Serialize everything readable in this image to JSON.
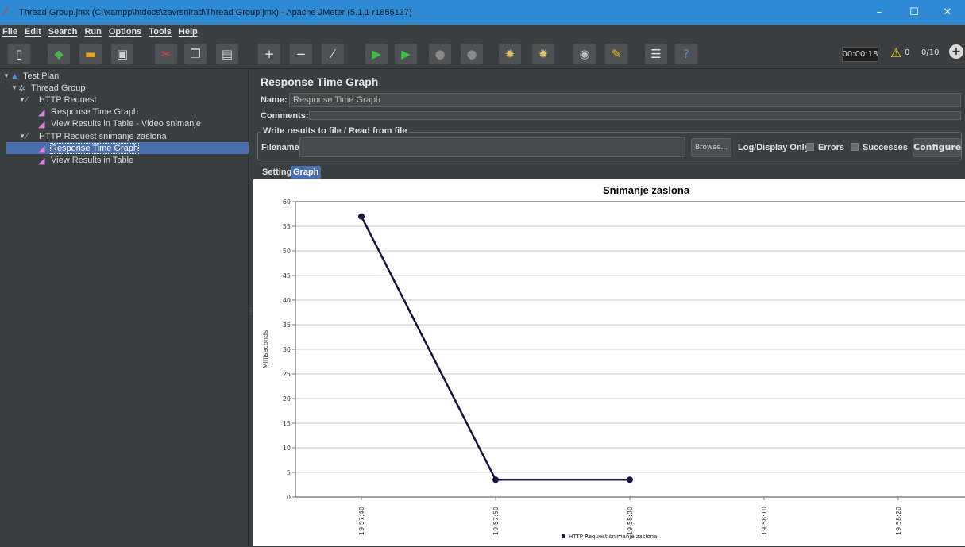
{
  "window": {
    "title": "Thread Group.jmx (C:\\xampp\\htdocs\\zavrsnirad\\Thread Group.jmx) - Apache JMeter (5.1.1 r1855137)",
    "minimize": "–",
    "maximize": "☐",
    "close": "✕"
  },
  "menu": [
    "File",
    "Edit",
    "Search",
    "Run",
    "Options",
    "Tools",
    "Help"
  ],
  "toolbar": {
    "buttons": [
      {
        "icon": "new-icon",
        "glyph": "▯",
        "color": "#f0f0f0"
      },
      {
        "icon": "templates-icon",
        "glyph": "◆",
        "color": "#4caf50"
      },
      {
        "icon": "open-icon",
        "glyph": "▬",
        "color": "#e6a817"
      },
      {
        "icon": "save-icon",
        "glyph": "▣",
        "color": "#cfcfcf"
      },
      {
        "icon": "cut-icon",
        "glyph": "✂",
        "color": "#e04848"
      },
      {
        "icon": "copy-icon",
        "glyph": "❐",
        "color": "#d8d8d8"
      },
      {
        "icon": "paste-icon",
        "glyph": "▤",
        "color": "#d8d8d8"
      },
      {
        "icon": "expand-icon",
        "glyph": "+",
        "color": "#e8e8e8"
      },
      {
        "icon": "collapse-icon",
        "glyph": "−",
        "color": "#e8e8e8"
      },
      {
        "icon": "toggle-icon",
        "glyph": "⁄",
        "color": "#d8d8d8"
      },
      {
        "icon": "start-icon",
        "glyph": "▶",
        "color": "#3fbf3f"
      },
      {
        "icon": "start-no-pauses-icon",
        "glyph": "▶",
        "color": "#3fbf3f"
      },
      {
        "icon": "stop-icon",
        "glyph": "●",
        "color": "#8a8a8a"
      },
      {
        "icon": "shutdown-icon",
        "glyph": "●",
        "color": "#8a8a8a"
      },
      {
        "icon": "clear-icon",
        "glyph": "✹",
        "color": "#e0c070"
      },
      {
        "icon": "clear-all-icon",
        "glyph": "✹",
        "color": "#e0c070"
      },
      {
        "icon": "search-icon",
        "glyph": "◉",
        "color": "#bbbbbb"
      },
      {
        "icon": "reset-search-icon",
        "glyph": "✎",
        "color": "#f0c000"
      },
      {
        "icon": "function-helper-icon",
        "glyph": "☰",
        "color": "#e0e0e0"
      },
      {
        "icon": "help-icon",
        "glyph": "?",
        "color": "#4a90e2"
      }
    ],
    "timer": "00:00:18",
    "warnings": "0",
    "threads": "0/10"
  },
  "tree": [
    {
      "label": "Test Plan",
      "icon": "testplan-icon",
      "level": 0,
      "expanded": true
    },
    {
      "label": "Thread Group",
      "icon": "threadgroup-icon",
      "level": 1,
      "expanded": true
    },
    {
      "label": "HTTP Request",
      "icon": "sampler-icon",
      "level": 2,
      "expanded": true
    },
    {
      "label": "Response Time Graph",
      "icon": "listener-icon",
      "level": 3
    },
    {
      "label": "View Results in Table - Video snimanje",
      "icon": "listener-icon",
      "level": 3
    },
    {
      "label": "HTTP Request snimanje zaslona",
      "icon": "sampler-icon",
      "level": 2,
      "expanded": true
    },
    {
      "label": "Response Time Graph",
      "icon": "listener-icon",
      "level": 3,
      "selected": true
    },
    {
      "label": "View Results in Table",
      "icon": "listener-icon",
      "level": 3
    }
  ],
  "panel": {
    "title": "Response Time Graph",
    "name_label": "Name:",
    "name_value": "Response Time Graph",
    "comments_label": "Comments:",
    "file_legend": "Write results to file / Read from file",
    "filename_label": "Filename",
    "browse": "Browse...",
    "log_display_only": "Log/Display Only:",
    "errors": "Errors",
    "successes": "Successes",
    "configure": "Configure",
    "tabs": [
      "Settings",
      "Graph"
    ],
    "active_tab": "Graph"
  },
  "chart_data": {
    "type": "line",
    "title": "Snimanje zaslona",
    "ylabel": "Milliseconds",
    "xlabel": "",
    "ylim": [
      0,
      60
    ],
    "yticks": [
      0,
      5,
      10,
      15,
      20,
      25,
      30,
      35,
      40,
      45,
      50,
      55,
      60
    ],
    "xticks": [
      "19:57:40",
      "19:57:50",
      "19:58:00",
      "19:58:10",
      "19:58:20"
    ],
    "grid": true,
    "legend_position": "bottom",
    "series": [
      {
        "name": "HTTP Request snimanje zaslona",
        "color": "#14143c",
        "x": [
          "19:57:40",
          "19:57:50",
          "19:58:00"
        ],
        "values": [
          57,
          3.5,
          3.5
        ]
      }
    ]
  }
}
